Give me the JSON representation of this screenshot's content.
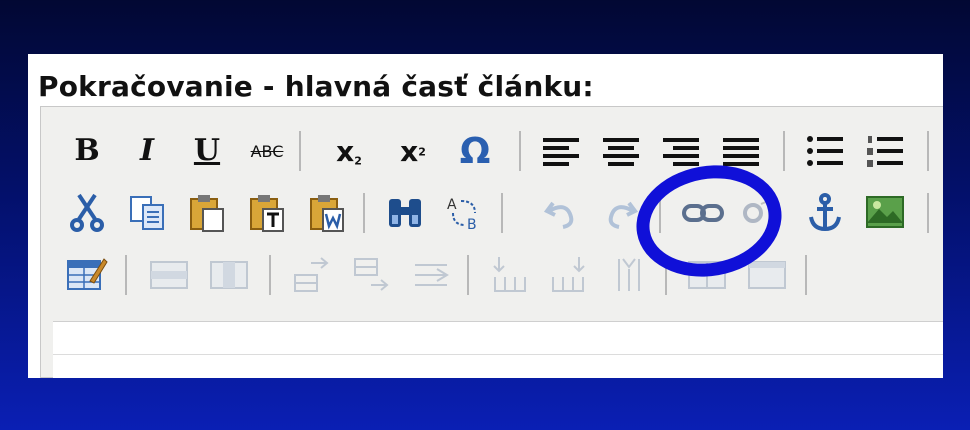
{
  "heading": "Pokračovanie - hlavná časť článku:",
  "toolbar": {
    "row1": {
      "bold_label": "B",
      "italic_label": "I",
      "underline_label": "U",
      "strike_label": "ABC",
      "subscript_label": "x",
      "subscript_sub": "2",
      "superscript_label": "x",
      "superscript_sup": "2",
      "special_char_label": "Ω",
      "icons": [
        "bold-icon",
        "italic-icon",
        "underline-icon",
        "strikethrough-icon",
        "subscript-icon",
        "superscript-icon",
        "omega-icon",
        "align-left-icon",
        "align-center-icon",
        "align-right-icon",
        "align-justify-icon",
        "bullet-list-icon",
        "numbered-list-icon"
      ]
    },
    "row2": {
      "icons": [
        "cut-icon",
        "copy-icon",
        "paste-icon",
        "paste-text-icon",
        "paste-word-icon",
        "find-icon",
        "replace-icon",
        "undo-icon",
        "redo-icon",
        "link-icon",
        "unlink-icon",
        "anchor-icon",
        "image-icon"
      ]
    },
    "row3": {
      "icons": [
        "edit-table-icon",
        "table-row-icon",
        "table-col-icon",
        "insert-row-before-icon",
        "insert-row-after-icon",
        "delete-row-icon",
        "insert-col-before-icon",
        "insert-col-after-icon",
        "delete-col-icon",
        "split-cell-icon",
        "merge-cell-icon"
      ]
    }
  },
  "colors": {
    "background_top": "#020833",
    "background_bottom": "#0a1fb4",
    "toolbar_bg": "#f0f0ee",
    "annotation": "#1010d8",
    "omega_blue": "#2a5fb0"
  }
}
